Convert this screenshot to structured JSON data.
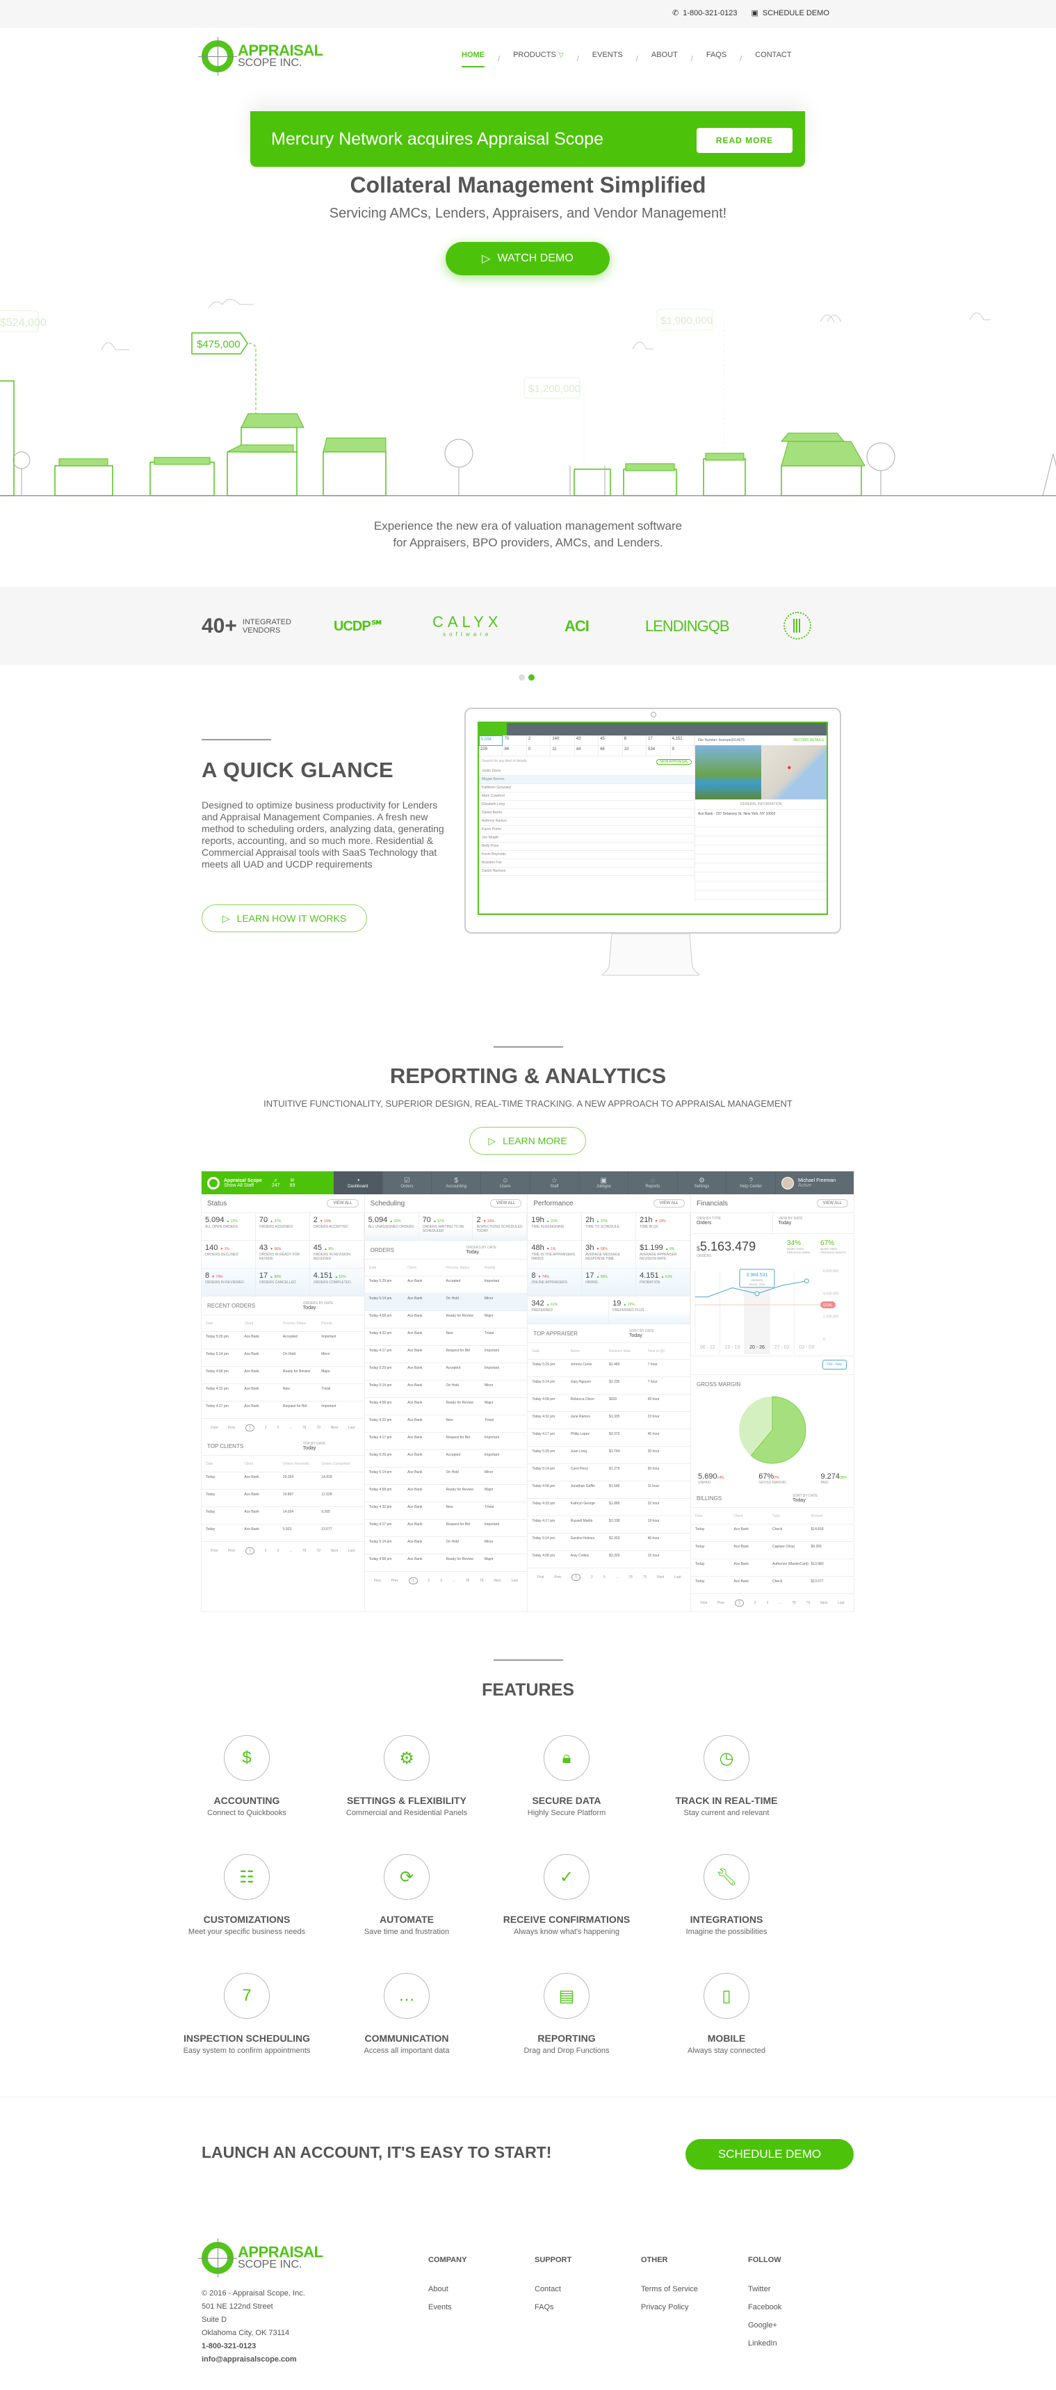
{
  "topbar": {
    "phone": "1-800-321-0123",
    "schedule_demo": "SCHEDULE DEMO"
  },
  "logo": {
    "line1": "APPRAISAL",
    "line2": "SCOPE INC."
  },
  "nav": {
    "items": [
      {
        "label": "HOME",
        "active": true
      },
      {
        "label": "PRODUCTS",
        "has_dropdown": true
      },
      {
        "label": "EVENTS"
      },
      {
        "label": "ABOUT"
      },
      {
        "label": "FAQS"
      },
      {
        "label": "CONTACT"
      }
    ]
  },
  "banner": {
    "text": "Mercury Network acquires Appraisal Scope",
    "button": "READ MORE"
  },
  "hero": {
    "title": "Collateral Management Simplified",
    "subtitle": "Servicing AMCs, Lenders, Appraisers, and Vendor Management!",
    "watch_demo": "WATCH DEMO",
    "price_tags": [
      "$524,000",
      "$475,000",
      "$1,200,000",
      "$1,900,000"
    ],
    "experience_line1": "Experience the new era of valuation management software",
    "experience_line2": "for Appraisers, BPO providers, AMCs, and Lenders."
  },
  "vendors": {
    "count": "40+",
    "count_label_1": "INTEGRATED",
    "count_label_2": "VENDORS",
    "logos": [
      "UCDP℠",
      "CALYX",
      "ACI",
      "LENDINGQB",
      "HUD"
    ],
    "calyx_sub": "software",
    "carousel_active": 2,
    "carousel_total": 2
  },
  "quick_glance": {
    "title": "A QUICK GLANCE",
    "text": "Designed to optimize business productivity for Lenders and Appraisal Management Companies. A fresh new method to scheduling orders, analyzing data, generating reports, accounting, and so much more. Residential & Commercial Appraisal tools with SaaS Technology that meets all UAD and UCDP requirements",
    "button": "LEARN HOW IT WORKS",
    "screen": {
      "stats_row1": [
        "5,094",
        "70",
        "2",
        "140",
        "43",
        "45",
        "8",
        "17",
        "4,151"
      ],
      "stats_row2": [
        "229",
        "86",
        "0",
        "11",
        "44",
        "66",
        "10",
        "534",
        "9"
      ],
      "search_placeholder": "Search for any kind of details",
      "new_appraisal": "NEW APPRAISAL",
      "export": "EXPORT",
      "file_number": "File Number: Asicope2014076",
      "record_details": "RECORD DETAILS",
      "general_info": "GENERAL INFORMATION",
      "rows": [
        "Justin Davis",
        "Megan Barnes",
        "Kathleen Gonzalez",
        "Mark Crawford",
        "Elizabeth Long",
        "Daniel Banks",
        "Anthony Ramos",
        "Karen Porter",
        "Joe Wright",
        "Betty Price",
        "Kevin Reynolds",
        "Brandon Fox",
        "Daniel Harrison"
      ],
      "client": "Ace Bank - 237 Delancey St, New York, NY 10002",
      "user": "Michael Freeman"
    }
  },
  "reporting": {
    "title": "REPORTING & ANALYTICS",
    "subtitle": "INTUITIVE FUNCTIONALITY, SUPERIOR DESIGN, REAL-TIME TRACKING. A NEW APPROACH TO APPRAISAL MANAGEMENT",
    "button": "LEARN MORE",
    "dashboard": {
      "company": "Appraisal Scope",
      "company_sub": "Show All Staff",
      "notifications": "247",
      "messages": "89",
      "tabs": [
        "Dashboard",
        "Orders",
        "Accounting",
        "Users",
        "Staff",
        "Jobtype",
        "Reports",
        "Settings",
        "Help Center"
      ],
      "user_name": "Michael Freeman",
      "user_status": "Active",
      "view_all": "VIEW ALL",
      "status": {
        "title": "Status",
        "stats": [
          {
            "v": "5.094",
            "d": "22%",
            "dir": "up",
            "l": "All open orders"
          },
          {
            "v": "70",
            "d": "37%",
            "dir": "up",
            "l": "Orders assigned"
          },
          {
            "v": "2",
            "d": "19%",
            "dir": "down",
            "l": "Orders accepted"
          },
          {
            "v": "140",
            "d": "1%",
            "dir": "down",
            "l": "Orders declined"
          },
          {
            "v": "43",
            "d": "56%",
            "dir": "down",
            "l": "Orders in ready for review"
          },
          {
            "v": "45",
            "d": "8%",
            "dir": "up",
            "l": "Orders in revision received"
          },
          {
            "v": "8",
            "d": "74%",
            "dir": "down",
            "l": "Orders in reviewed"
          },
          {
            "v": "17",
            "d": "89%",
            "dir": "up",
            "l": "Orders cancelled"
          },
          {
            "v": "4.151",
            "d": "61%",
            "dir": "up",
            "l": "Orders completed"
          }
        ],
        "recent_orders": {
          "title": "RECENT ORDERS",
          "filter_label": "ORDERS BY DATE",
          "filter_value": "Today",
          "headers": [
            "Date",
            "Client",
            "Process Status",
            "Priority"
          ],
          "rows": [
            [
              "Today 5:29 pm",
              "Ace Bank",
              "Accepted",
              "Important"
            ],
            [
              "Today 5:14 pm",
              "Ace Bank",
              "On Hold",
              "Minor"
            ],
            [
              "Today 4:58 pm",
              "Ace Bank",
              "Ready for Review",
              "Major"
            ],
            [
              "Today 4:32 pm",
              "Ace Bank",
              "New",
              "Trivial"
            ],
            [
              "Today 4:17 pm",
              "Ace Bank",
              "Request for Bid",
              "Important"
            ]
          ]
        },
        "top_clients": {
          "title": "TOP CLIENTS",
          "filter_label": "TOP BY DATE",
          "filter_value": "Today",
          "headers": [
            "Date",
            "Client",
            "Orders Received",
            "Orders Completed"
          ],
          "rows": [
            [
              "Today",
              "Ace Bank",
              "29.254",
              "14.818"
            ],
            [
              "Today",
              "Ace Bank",
              "19.897",
              "12.528"
            ],
            [
              "Today",
              "Ace Bank",
              "14.034",
              "9.265"
            ],
            [
              "Today",
              "Ace Bank",
              "5.923",
              "13.077"
            ]
          ]
        }
      },
      "scheduling": {
        "title": "Scheduling",
        "stats": [
          {
            "v": "5.094",
            "d": "22%",
            "dir": "up",
            "l": "All unassigned orders"
          },
          {
            "v": "70",
            "d": "37%",
            "dir": "up",
            "l": "Orders waiting to be scheduled"
          },
          {
            "v": "2",
            "d": "19%",
            "dir": "down",
            "l": "Inspections scheduled today"
          }
        ],
        "orders": {
          "title": "ORDERS",
          "filter_label": "ORDERS BY DATE",
          "filter_value": "Today",
          "headers": [
            "Date",
            "Client",
            "Process Status",
            "Priority"
          ],
          "rows": [
            [
              "Today 5:29 pm",
              "Ace Bank",
              "Accepted",
              "Important"
            ],
            [
              "Today 5:14 pm",
              "Ace Bank",
              "On Hold",
              "Minor"
            ],
            [
              "Today 4:58 pm",
              "Ace Bank",
              "Ready for Review",
              "Major"
            ],
            [
              "Today 4:32 pm",
              "Ace Bank",
              "New",
              "Trivial"
            ],
            [
              "Today 4:17 pm",
              "Ace Bank",
              "Request for Bid",
              "Important"
            ],
            [
              "Today 5:29 pm",
              "Ace Bank",
              "Accepted",
              "Important"
            ],
            [
              "Today 5:14 pm",
              "Ace Bank",
              "On Hold",
              "Minor"
            ],
            [
              "Today 4:58 pm",
              "Ace Bank",
              "Ready for Review",
              "Major"
            ],
            [
              "Today 4:32 pm",
              "Ace Bank",
              "New",
              "Trivial"
            ],
            [
              "Today 4:17 pm",
              "Ace Bank",
              "Request for Bid",
              "Important"
            ],
            [
              "Today 5:29 pm",
              "Ace Bank",
              "Accepted",
              "Important"
            ],
            [
              "Today 5:14 pm",
              "Ace Bank",
              "On Hold",
              "Minor"
            ],
            [
              "Today 4:58 pm",
              "Ace Bank",
              "Ready for Review",
              "Major"
            ],
            [
              "Today 4:32 pm",
              "Ace Bank",
              "New",
              "Trivial"
            ],
            [
              "Today 4:17 pm",
              "Ace Bank",
              "Request for Bid",
              "Important"
            ],
            [
              "Today 5:14 pm",
              "Ace Bank",
              "On Hold",
              "Minor"
            ],
            [
              "Today 4:58 pm",
              "Ace Bank",
              "Ready for Review",
              "Major"
            ]
          ]
        }
      },
      "performance": {
        "title": "Performance",
        "stats": [
          {
            "v": "19h",
            "d": "22%",
            "dir": "up",
            "l": "Time in assigning"
          },
          {
            "v": "2h",
            "d": "37%",
            "dir": "up",
            "l": "Time to schedule"
          },
          {
            "v": "21h",
            "d": "19%",
            "dir": "down",
            "l": "Time in QC"
          },
          {
            "v": "48h",
            "d": "1%",
            "dir": "down",
            "l": "Time in the appraisers hands"
          },
          {
            "v": "3h",
            "d": "56%",
            "dir": "down",
            "l": "Average message response time"
          },
          {
            "v": "$1.199",
            "d": "8%",
            "dir": "up",
            "l": "Average appraiser revision rate"
          },
          {
            "v": "8",
            "d": "74%",
            "dir": "down",
            "l": "Online appraisers"
          },
          {
            "v": "17",
            "d": "89%",
            "dir": "up",
            "l": "Hiring"
          },
          {
            "v": "4.151",
            "d": "61%",
            "dir": "up",
            "l": "Probation"
          }
        ],
        "extra_stats": [
          {
            "v": "342",
            "d": "61%",
            "dir": "up",
            "l": "Preferred"
          },
          {
            "v": "19",
            "d": "22%",
            "dir": "up",
            "l": "Preferred plus"
          }
        ],
        "top_appraiser": {
          "title": "TOP APPRAISER",
          "filter_label": "SORT BY DATE",
          "filter_value": "Today",
          "headers": [
            "Date",
            "Name",
            "Revision Rate",
            "Time in QC"
          ],
          "rows": [
            [
              "Today 5:29 pm",
              "Johnny Curtis",
              "$2.483",
              "7 hour"
            ],
            [
              "Today 5:14 pm",
              "Gary Nguyen",
              "$2.205",
              "7 hour"
            ],
            [
              "Today 4:58 pm",
              "Rebecca Olson",
              "$620",
              "45 hour"
            ],
            [
              "Today 4:32 pm",
              "Jane Ramos",
              "$1.335",
              "23 hour"
            ],
            [
              "Today 4:17 pm",
              "Philip Lopez",
              "$2.072",
              "45 hour"
            ],
            [
              "Today 5:29 pm",
              "Juan Long",
              "$1.744",
              "30 hour"
            ],
            [
              "Today 5:14 pm",
              "Carol Perry",
              "$1.275",
              "30 hour"
            ],
            [
              "Today 4:58 pm",
              "Jonathan Griffin",
              "$1.646",
              "11 hour"
            ],
            [
              "Today 4:32 pm",
              "Kathryn George",
              "$1.885",
              "32 hour"
            ],
            [
              "Today 4:17 pm",
              "Russell Martin",
              "$2.338",
              "19 hour"
            ],
            [
              "Today 5:14 pm",
              "Sandra Holmes",
              "$2.303",
              "46 hour"
            ],
            [
              "Today 4:58 pm",
              "Amy Collins",
              "$2.329",
              "15 hour"
            ]
          ]
        }
      },
      "financials": {
        "title": "Financials",
        "view_type_label": "VIEW BY TYPE",
        "view_type": "Orders",
        "view_date_label": "VIEW BY DATE",
        "view_date": "Today",
        "total_prefix": "$",
        "total": "5.163.479",
        "total_label": "ORDERS",
        "week_pct": "34%",
        "week_label": "MORE THEN PREVIOUS WEEK",
        "month_pct": "67%",
        "month_label": "MORE THEN PREVIOUS MONTH",
        "tooltip_value": "3.984.531",
        "tooltip_label": "ORDERS",
        "tooltip_date": "Oct 09, 2016",
        "goal_label": "GOAL",
        "range_label": "Oct - Nov",
        "gross_margin": {
          "title": "GROSS MARGIN",
          "unpaid": "5.690",
          "unpaid_d": "14%",
          "unpaid_label": "UNPAID",
          "margin": "67%",
          "margin_d": "2%",
          "margin_label": "GROSS MARGIN",
          "paid": "9.274",
          "paid_d": "35%",
          "paid_label": "PAID",
          "paid_fraction": 0.61
        },
        "billings": {
          "title": "BILLINGS",
          "filter_label": "SORT BY DATE",
          "filter_value": "Today",
          "headers": [
            "Date",
            "Client",
            "Type",
            "Amount"
          ],
          "rows": [
            [
              "Today",
              "Ace Bank",
              "Check",
              "$14.818"
            ],
            [
              "Today",
              "Ace Bank",
              "Capture (Visa)",
              "$9.265"
            ],
            [
              "Today",
              "Ace Bank",
              "Authorize (MasterCard)",
              "$13.983"
            ],
            [
              "Today",
              "Ace Bank",
              "Check",
              "$13.077"
            ]
          ]
        }
      },
      "pager": [
        "First",
        "Prev",
        "1",
        "2",
        "3",
        "...",
        "78",
        "79",
        "Next",
        "Last"
      ]
    }
  },
  "chart_data": {
    "type": "line",
    "title": "Financials",
    "categories": [
      "06 - 12",
      "13 - 19",
      "20 - 26",
      "27 - 02",
      "03 - 09"
    ],
    "series": [
      {
        "name": "Orders",
        "values": [
          3700000,
          4500000,
          3984531,
          4700000,
          5100000
        ]
      }
    ],
    "ylim": [
      0,
      6000000
    ],
    "yticks": [
      "0",
      "2.000.000",
      "4.000.000",
      "6.000.000"
    ],
    "goal": 3000000,
    "highlighted": {
      "category": "20 - 26",
      "value": 3984531,
      "label": "3.984.531"
    }
  },
  "features": {
    "title": "FEATURES",
    "items": [
      {
        "icon": "dollar",
        "title": "ACCOUNTING",
        "sub": "Connect to Quickbooks"
      },
      {
        "icon": "gear",
        "title": "SETTINGS & FLEXIBILITY",
        "sub": "Commercial and Residential Panels"
      },
      {
        "icon": "lock",
        "title": "SECURE DATA",
        "sub": "Highly Secure Platform"
      },
      {
        "icon": "clock",
        "title": "TRACK IN REAL-TIME",
        "sub": "Stay current and relevant"
      },
      {
        "icon": "sliders",
        "title": "CUSTOMIZATIONS",
        "sub": "Meet your specific business needs"
      },
      {
        "icon": "refresh",
        "title": "AUTOMATE",
        "sub": "Save time and frustration"
      },
      {
        "icon": "check-circle",
        "title": "RECEIVE CONFIRMATIONS",
        "sub": "Always know what's happening"
      },
      {
        "icon": "wrench",
        "title": "INTEGRATIONS",
        "sub": "Imagine the possibilities"
      },
      {
        "icon": "calendar",
        "title": "INSPECTION SCHEDULING",
        "sub": "Easy system to confirm appointments",
        "calendar_day": "7"
      },
      {
        "icon": "chat",
        "title": "COMMUNICATION",
        "sub": "Access all important data"
      },
      {
        "icon": "clipboard",
        "title": "REPORTING",
        "sub": "Drag and Drop Functions"
      },
      {
        "icon": "mobile",
        "title": "MOBILE",
        "sub": "Always stay connected"
      }
    ]
  },
  "cta": {
    "text": "LAUNCH AN ACCOUNT, IT'S EASY TO START!",
    "button": "SCHEDULE DEMO"
  },
  "footer": {
    "copyright": "© 2016 - Appraisal Scope, Inc.",
    "address1": "501 NE 122nd Street",
    "address2": "Suite D",
    "address3": "Oklahoma City, OK 73114",
    "phone": "1-800-321-0123",
    "email": "info@appraisalscope.com",
    "columns": [
      {
        "title": "COMPANY",
        "links": [
          "About",
          "Events"
        ]
      },
      {
        "title": "SUPPORT",
        "links": [
          "Contact",
          "FAQs"
        ]
      },
      {
        "title": "OTHER",
        "links": [
          "Terms of Service",
          "Privacy Policy"
        ]
      },
      {
        "title": "FOLLOW",
        "links": [
          "Twitter",
          "Facebook",
          "Google+",
          "LinkedIn"
        ]
      }
    ]
  },
  "colors": {
    "brand_green": "#4cc30a",
    "text_dark": "#555555",
    "nav_gray": "#5f6b73",
    "chart_blue": "#4ba3d9",
    "goal_red": "#f28b8b"
  }
}
